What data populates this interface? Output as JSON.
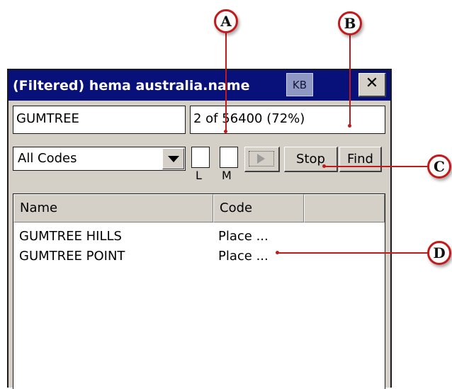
{
  "window": {
    "title": "(Filtered) hema australia.name",
    "kb_label": "KB",
    "close_glyph": "✕"
  },
  "search": {
    "value": "GUMTREE",
    "status": "2 of 56400 (72%)"
  },
  "filter": {
    "codes_selected": "All Codes",
    "checkbox_l_label": "L",
    "checkbox_m_label": "M",
    "stop_label": "Stop",
    "find_label": "Find"
  },
  "results": {
    "columns": [
      "Name",
      "Code"
    ],
    "rows": [
      {
        "name": "GUMTREE HILLS",
        "code": "Place ..."
      },
      {
        "name": "GUMTREE POINT",
        "code": "Place ..."
      }
    ]
  },
  "callouts": {
    "a": "A",
    "b": "B",
    "c": "C",
    "d": "D"
  },
  "colors": {
    "titlebar": "#08107a",
    "callout": "#c21a1a",
    "chrome": "#d4d0c8"
  }
}
